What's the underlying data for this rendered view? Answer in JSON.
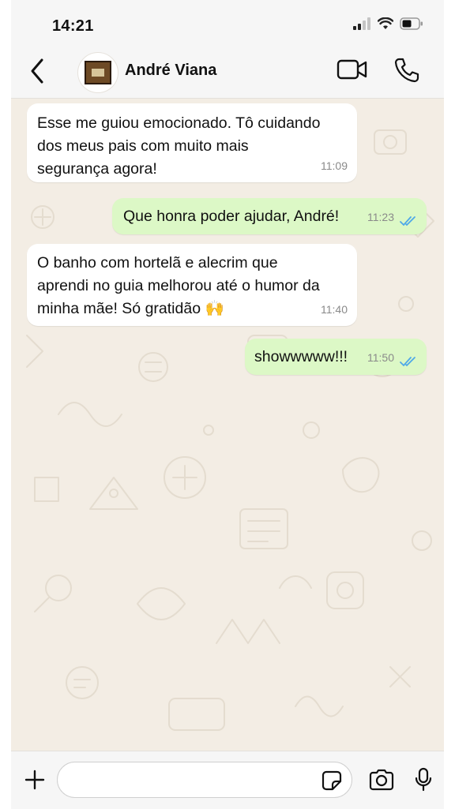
{
  "status_bar": {
    "time": "14:21"
  },
  "header": {
    "contact_name": "André Viana"
  },
  "messages": [
    {
      "direction": "in",
      "lines": [
        "Esse me guiou emocionado. Tô cuidando",
        "dos meus pais com muito mais",
        "segurança agora!"
      ],
      "time": "11:09"
    },
    {
      "direction": "out",
      "text": "Que honra poder ajudar, André!",
      "time": "11:23",
      "status": "read"
    },
    {
      "direction": "in",
      "lines": [
        "O banho com hortelã e alecrim que",
        "aprendi no guia melhorou até o humor da",
        "minha mãe! Só gratidão 🙌"
      ],
      "time": "11:40"
    },
    {
      "direction": "out",
      "text": "showwwww!!!",
      "time": "11:50",
      "status": "read"
    }
  ],
  "input": {
    "placeholder": "",
    "value": ""
  },
  "colors": {
    "chat_background": "#f3ede4",
    "incoming_bubble": "#ffffff",
    "outgoing_bubble": "#dcf8c6",
    "read_ticks": "#4fa8e8",
    "bars": "#f6f6f6"
  },
  "icons": [
    "signal-icon",
    "wifi-icon",
    "battery-icon",
    "back-icon",
    "video-call-icon",
    "voice-call-icon",
    "plus-icon",
    "sticker-icon",
    "camera-icon",
    "mic-icon"
  ]
}
